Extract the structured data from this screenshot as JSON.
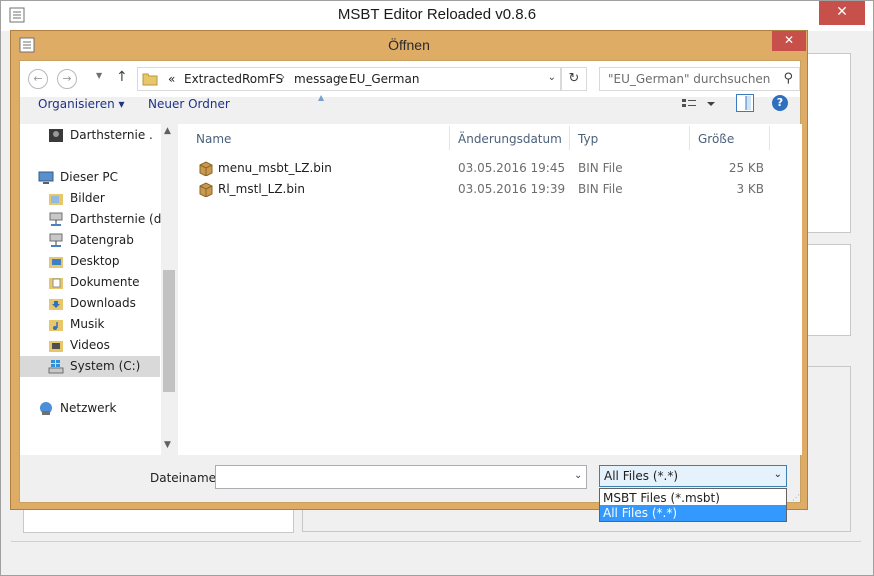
{
  "main_window": {
    "title": "MSBT Editor Reloaded v0.8.6",
    "close_symbol": "✕"
  },
  "dialog": {
    "title": "Öffnen",
    "close_symbol": "✕",
    "address": {
      "overflow": "«",
      "crumbs": [
        "ExtractedRomFS",
        "message",
        "EU_German"
      ],
      "separator": "›"
    },
    "search": {
      "placeholder": "\"EU_German\" durchsuchen"
    },
    "toolbar": {
      "organize_label": "Organisieren ▾",
      "new_folder_label": "Neuer Ordner",
      "help_symbol": "?"
    },
    "nav_pane": {
      "items": [
        {
          "label": "Darthsternie .",
          "icon": "user-avatar-icon"
        },
        {
          "label": "Dieser PC",
          "icon": "computer-icon"
        },
        {
          "label": "Bilder",
          "icon": "pictures-folder-icon"
        },
        {
          "label": "Darthsternie (dar",
          "icon": "network-drive-icon"
        },
        {
          "label": "Datengrab",
          "icon": "network-drive-icon"
        },
        {
          "label": "Desktop",
          "icon": "desktop-folder-icon"
        },
        {
          "label": "Dokumente",
          "icon": "documents-folder-icon"
        },
        {
          "label": "Downloads",
          "icon": "downloads-folder-icon"
        },
        {
          "label": "Musik",
          "icon": "music-folder-icon"
        },
        {
          "label": "Videos",
          "icon": "videos-folder-icon"
        },
        {
          "label": "System (C:)",
          "icon": "windows-drive-icon"
        },
        {
          "label": "Netzwerk",
          "icon": "network-icon"
        }
      ]
    },
    "file_list": {
      "columns": [
        "Name",
        "Änderungsdatum",
        "Typ",
        "Größe"
      ],
      "rows": [
        {
          "name": "menu_msbt_LZ.bin",
          "date": "03.05.2016 19:45",
          "type": "BIN File",
          "size": "25 KB"
        },
        {
          "name": "Rl_mstl_LZ.bin",
          "date": "03.05.2016 19:39",
          "type": "BIN File",
          "size": "3 KB"
        }
      ]
    },
    "filename": {
      "label": "Dateiname:",
      "value": ""
    },
    "filter": {
      "selected": "All Files (*.*)",
      "options": [
        "MSBT Files (*.msbt)",
        "All Files (*.*)"
      ]
    }
  },
  "colors": {
    "dialog_frame": "#dfac66",
    "close_button": "#c7504b",
    "link_text": "#1e3287",
    "selection": "#3399ff"
  }
}
